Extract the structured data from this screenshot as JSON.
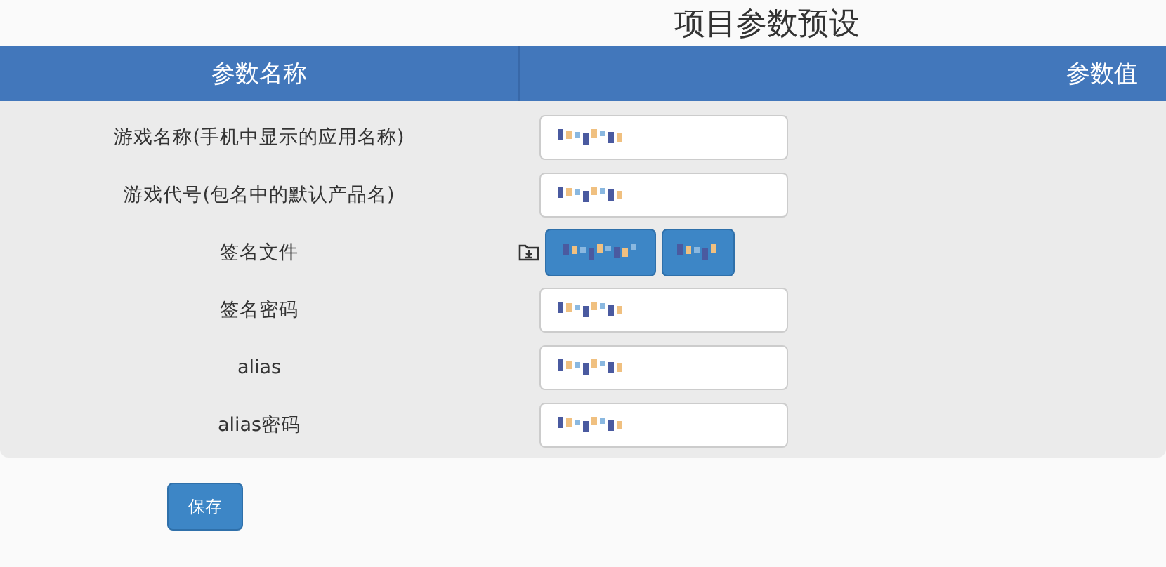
{
  "title": "项目参数预设",
  "columns": [
    "参数名称",
    "参数值"
  ],
  "rows": [
    {
      "label": "游戏名称(手机中显示的应用名称)",
      "kind": "field"
    },
    {
      "label": "游戏代号(包名中的默认产品名)",
      "kind": "field"
    },
    {
      "label": "签名文件",
      "kind": "file"
    },
    {
      "label": "签名密码",
      "kind": "field"
    },
    {
      "label": "alias",
      "kind": "field"
    },
    {
      "label": "alias密码",
      "kind": "field"
    }
  ],
  "save_button": "保存"
}
